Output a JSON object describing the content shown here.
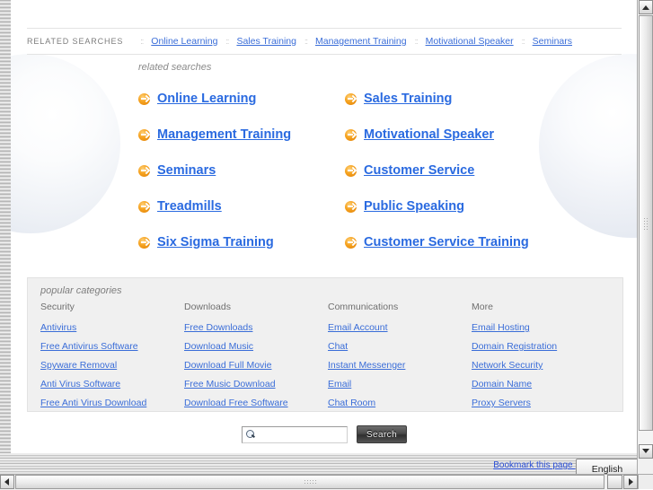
{
  "top_bar": {
    "label": "RELATED SEARCHES",
    "separator": "::",
    "links": [
      "Online Learning",
      "Sales Training",
      "Management Training",
      "Motivational Speaker",
      "Seminars"
    ]
  },
  "main": {
    "heading": "related searches",
    "rows": [
      {
        "left": "Online Learning",
        "right": "Sales Training"
      },
      {
        "left": "Management Training",
        "right": "Motivational Speaker"
      },
      {
        "left": "Seminars",
        "right": "Customer Service"
      },
      {
        "left": "Treadmills",
        "right": "Public Speaking"
      },
      {
        "left": "Six Sigma Training",
        "right": "Customer Service Training"
      }
    ]
  },
  "categories": {
    "title": "popular categories",
    "columns": [
      {
        "heading": "Security",
        "links": [
          "Antivirus",
          "Free Antivirus Software",
          "Spyware Removal",
          "Anti Virus Software",
          "Free Anti Virus Download"
        ]
      },
      {
        "heading": "Downloads",
        "links": [
          "Free Downloads",
          "Download Music",
          "Download Full Movie",
          "Free Music Download",
          "Download Free Software"
        ]
      },
      {
        "heading": "Communications",
        "links": [
          "Email Account",
          "Chat",
          "Instant Messenger",
          "Email",
          "Chat Room"
        ]
      },
      {
        "heading": "More",
        "links": [
          "Email Hosting",
          "Domain Registration",
          "Network Security",
          "Domain Name",
          "Proxy Servers"
        ]
      }
    ]
  },
  "search": {
    "value": "",
    "placeholder": "",
    "button_label": "Search"
  },
  "footer": {
    "bookmark_label": "Bookmark this page |",
    "language": "English"
  },
  "colors": {
    "link_blue": "#3a6dd8",
    "main_link_blue": "#2a6ae0",
    "arrow_orange": "#f5a11d",
    "panel_gray": "#f0f0f0"
  }
}
